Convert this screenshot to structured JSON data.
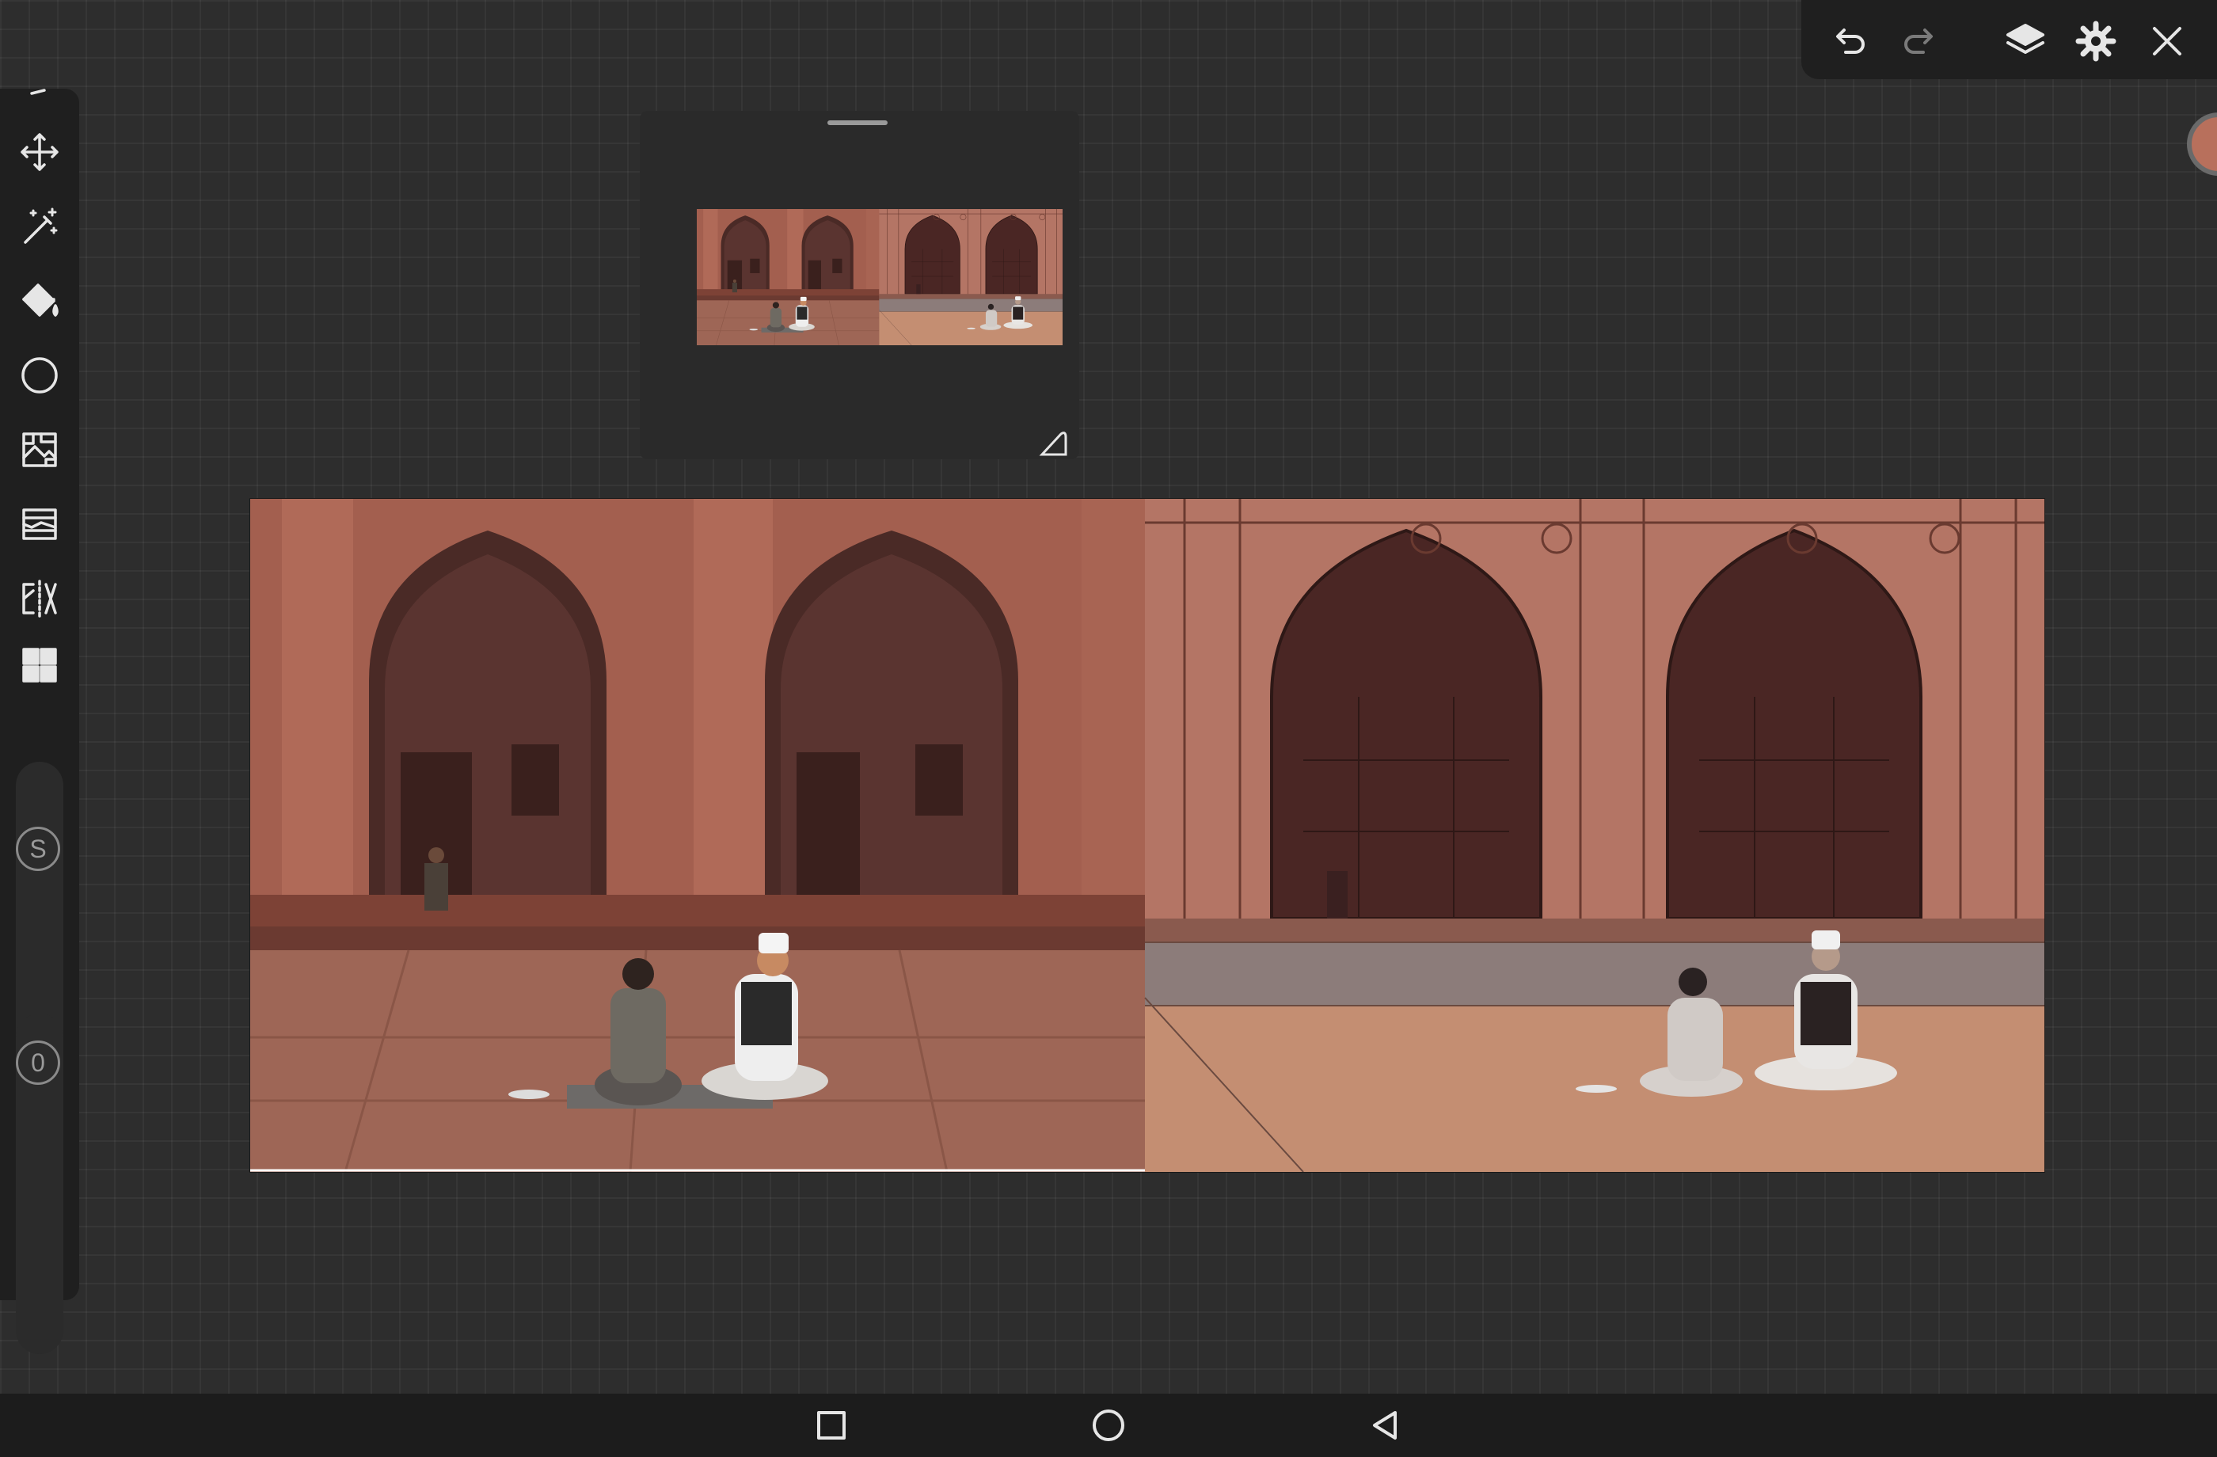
{
  "app": {
    "name": "Drawing canvas"
  },
  "toolbar": {
    "tools": [
      {
        "name": "select-tool",
        "icon": "selection-icon"
      },
      {
        "name": "transform-tool",
        "icon": "move-arrows-icon"
      },
      {
        "name": "adjust-tool",
        "icon": "magic-wand-icon"
      },
      {
        "name": "fill-tool",
        "icon": "paint-bucket-icon"
      },
      {
        "name": "shape-tool",
        "icon": "circle-icon"
      },
      {
        "name": "image-tool",
        "icon": "image-grid-icon"
      },
      {
        "name": "panel-tool",
        "icon": "frame-icon"
      },
      {
        "name": "symmetry-tool",
        "icon": "symmetry-icon"
      },
      {
        "name": "gallery-tool",
        "icon": "grid-icon"
      }
    ],
    "size_label": "S",
    "opacity_label": "0"
  },
  "topbar": {
    "actions": [
      "undo",
      "redo",
      "layers",
      "settings",
      "close"
    ],
    "icons": [
      "undo-icon",
      "redo-icon",
      "layers-icon",
      "gear-icon",
      "close-icon"
    ]
  },
  "colors": {
    "background": "#2d2d2d",
    "panel": "#1f1f1f",
    "icon": "#e6e6e6",
    "current_color": "#b8705c",
    "sandstone": "#a35f4f",
    "sketch_tone": "#b87a6a"
  },
  "reference": {
    "description_label": ""
  },
  "navbar": {
    "icons": [
      "recent-apps-icon",
      "home-icon",
      "back-icon"
    ]
  }
}
